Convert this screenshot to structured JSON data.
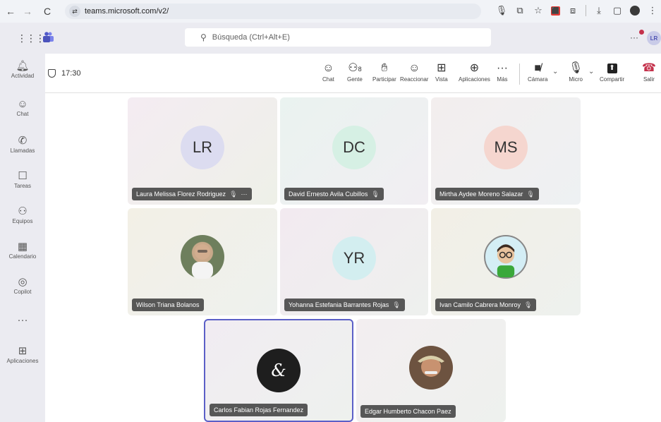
{
  "browser": {
    "url": "teams.microsoft.com/v2/",
    "back_icon": "←",
    "forward_icon": "→",
    "reload_icon": "C",
    "site_icon": "⇄",
    "right_icons": [
      "🎙",
      "⧉",
      "☆",
      "⤓",
      "▢"
    ]
  },
  "teams": {
    "search_placeholder": "Búsqueda (Ctrl+Alt+E)",
    "user_initials": "LR",
    "more": "···"
  },
  "rail": {
    "items": [
      {
        "label": "Actividad",
        "icon": "bell-icon",
        "glyph": "🔔"
      },
      {
        "label": "Chat",
        "icon": "chat-icon",
        "glyph": "☺"
      },
      {
        "label": "Llamadas",
        "icon": "phone-icon",
        "glyph": "✆"
      },
      {
        "label": "Tareas",
        "icon": "tasks-icon",
        "glyph": "☐"
      },
      {
        "label": "Equipos",
        "icon": "teams-icon",
        "glyph": "⚇"
      },
      {
        "label": "Calendario",
        "icon": "calendar-icon",
        "glyph": "▦"
      },
      {
        "label": "Copilot",
        "icon": "copilot-icon",
        "glyph": "◎"
      },
      {
        "label": "",
        "icon": "more-icon",
        "glyph": "···"
      },
      {
        "label": "Aplicaciones",
        "icon": "apps-icon",
        "glyph": "⊞"
      }
    ]
  },
  "meeting": {
    "time": "17:30",
    "controls": [
      {
        "label": "Chat",
        "glyph": "☺",
        "icon": "chat-icon"
      },
      {
        "label": "Gente",
        "glyph": "👥8",
        "icon": "people-icon"
      },
      {
        "label": "Participar",
        "glyph": "✋",
        "icon": "raise-hand-icon"
      },
      {
        "label": "Reaccionar",
        "glyph": "☺",
        "icon": "react-icon"
      },
      {
        "label": "Vista",
        "glyph": "⊞",
        "icon": "view-icon"
      },
      {
        "label": "Aplicaciones",
        "glyph": "⊕",
        "icon": "apps-icon"
      },
      {
        "label": "Más",
        "glyph": "···",
        "icon": "more-icon"
      },
      {
        "label": "Cámara",
        "glyph": "🎥",
        "icon": "camera-off-icon"
      },
      {
        "label": "Micro",
        "glyph": "🎙",
        "icon": "mic-off-icon"
      },
      {
        "label": "Compartir",
        "glyph": "⬆",
        "icon": "share-icon"
      },
      {
        "label": "Salir",
        "glyph": "☎",
        "icon": "leave-icon"
      }
    ],
    "participants_count": "8"
  },
  "participants": [
    {
      "name": "Laura Melissa Florez Rodriguez",
      "initials": "LR",
      "muted": true,
      "more": "···",
      "avatar_bg": "#dcdcf0",
      "tile_bg": "#f3eef3"
    },
    {
      "name": "David Ernesto Avila Cubillos",
      "initials": "DC",
      "muted": true,
      "more": "",
      "avatar_bg": "#d6f0e4",
      "tile_bg": "#eef4f0"
    },
    {
      "name": "Mirtha Aydee Moreno Salazar",
      "initials": "MS",
      "muted": true,
      "more": "",
      "avatar_bg": "#f5d6cf",
      "tile_bg": "#f2efef"
    },
    {
      "name": "Wilson Triana Bolanos",
      "initials": "",
      "muted": false,
      "more": "",
      "avatar_bg": "#7a8a6a",
      "tile_bg": "#f3f0e8"
    },
    {
      "name": "Yohanna Estefania Barrantes Rojas",
      "initials": "YR",
      "muted": true,
      "more": "",
      "avatar_bg": "#d3eef0",
      "tile_bg": "#f2ecf0"
    },
    {
      "name": "Ivan Camilo Cabrera Monroy",
      "initials": "",
      "muted": true,
      "more": "",
      "avatar_bg": "#d4eef5",
      "tile_bg": "#f1efe8"
    },
    {
      "name": "Carlos Fabian Rojas Fernandez",
      "initials": "",
      "muted": false,
      "more": "",
      "avatar_bg": "#1e1e1e",
      "tile_bg": "#f1eef2"
    },
    {
      "name": "Edgar Humberto Chacon Paez",
      "initials": "",
      "muted": false,
      "more": "",
      "avatar_bg": "#8a6a4a",
      "tile_bg": "#f3eef0"
    }
  ],
  "colors": {
    "accent": "#5b5fc7",
    "leave": "#c4314b",
    "rail_bg": "#ebebf1"
  }
}
